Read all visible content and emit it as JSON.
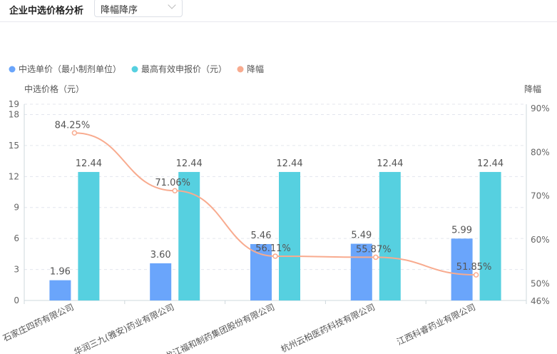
{
  "header": {
    "title": "企业中选价格分析",
    "sort_select": "降幅降序"
  },
  "chart_data": {
    "type": "bar",
    "categories": [
      "石家庄四药有限公司",
      "华润三九(雅安)药业有限公司",
      "黑龙江福和制药集团股份有限公司",
      "杭州云柏医药科技有限公司",
      "江西科睿药业有限公司"
    ],
    "series": [
      {
        "name": "中选单价（最小制剂单位）",
        "type": "bar",
        "color": "#6aa5fb",
        "values": [
          1.96,
          3.6,
          5.46,
          5.49,
          5.99
        ],
        "labels": [
          "1.96",
          "3.60",
          "5.46",
          "5.49",
          "5.99"
        ]
      },
      {
        "name": "最高有效申报价（元）",
        "type": "bar",
        "color": "#56d0e0",
        "values": [
          12.44,
          12.44,
          12.44,
          12.44,
          12.44
        ],
        "labels": [
          "12.44",
          "12.44",
          "12.44",
          "12.44",
          "12.44"
        ]
      },
      {
        "name": "降幅",
        "type": "line",
        "axis": "right",
        "color": "#f8ab8f",
        "values": [
          84.25,
          71.06,
          56.11,
          55.87,
          51.85
        ],
        "labels": [
          "84.25%",
          "71.06%",
          "56.11%",
          "55.87%",
          "51.85%"
        ]
      }
    ],
    "ylabel": "中选价格（元）",
    "y2label": "降幅",
    "ylim": [
      0,
      19
    ],
    "yticks": [
      "0",
      "3",
      "6",
      "9",
      "12",
      "15",
      "18",
      "19"
    ],
    "ytick_values": [
      0,
      3,
      6,
      9,
      12,
      15,
      18,
      19
    ],
    "y2lim": [
      46,
      90
    ],
    "y2ticks": [
      "46%",
      "50%",
      "60%",
      "70%",
      "80%",
      "90%"
    ],
    "y2tick_values": [
      46,
      50,
      60,
      70,
      80,
      90
    ],
    "legend": "top-left",
    "grid": true
  }
}
